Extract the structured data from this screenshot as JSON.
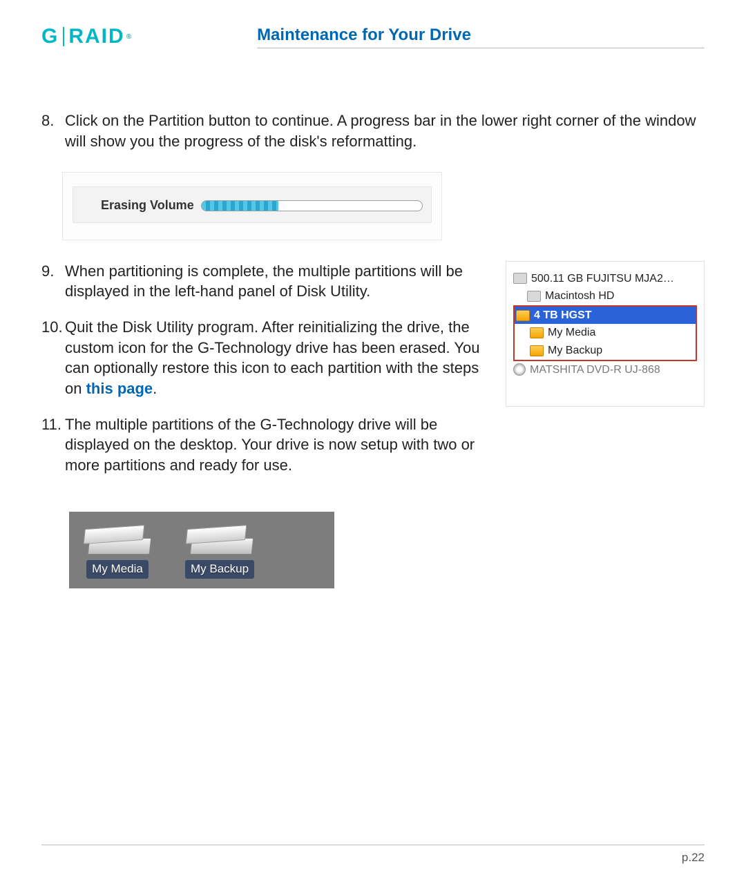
{
  "header": {
    "logo_g": "G",
    "logo_raid": "RAID",
    "logo_reg": "®",
    "section_title": "Maintenance for Your Drive"
  },
  "steps": {
    "s8": {
      "num": "8.",
      "text": "Click on the Partition button to continue. A progress bar in the lower right corner of the window will show you the progress of the disk's reformatting."
    },
    "s9": {
      "num": "9.",
      "text": "When partitioning is complete, the multiple partitions will be displayed in the left-hand panel of Disk Utility."
    },
    "s10": {
      "num": "10.",
      "text_a": "Quit the Disk Utility program. After reinitializing the drive, the custom icon for the G-Technology drive has been erased. You can optionally restore this icon to each partition with the steps on ",
      "link": "this page",
      "text_b": "."
    },
    "s11": {
      "num": "11.",
      "text": "The multiple partitions of the G-Technology drive will be displayed on the desktop. Your drive is now setup with two or more partitions and ready for use."
    }
  },
  "erase": {
    "label": "Erasing Volume"
  },
  "disk_panel": {
    "d0": "500.11 GB FUJITSU MJA2…",
    "d0a": "Macintosh HD",
    "d1": "4 TB HGST",
    "d1a": "My Media",
    "d1b": "My Backup",
    "d2": "MATSHITA DVD-R UJ-868"
  },
  "desktop": {
    "i1": "My Media",
    "i2": "My Backup"
  },
  "footer": {
    "page": "p.22"
  }
}
